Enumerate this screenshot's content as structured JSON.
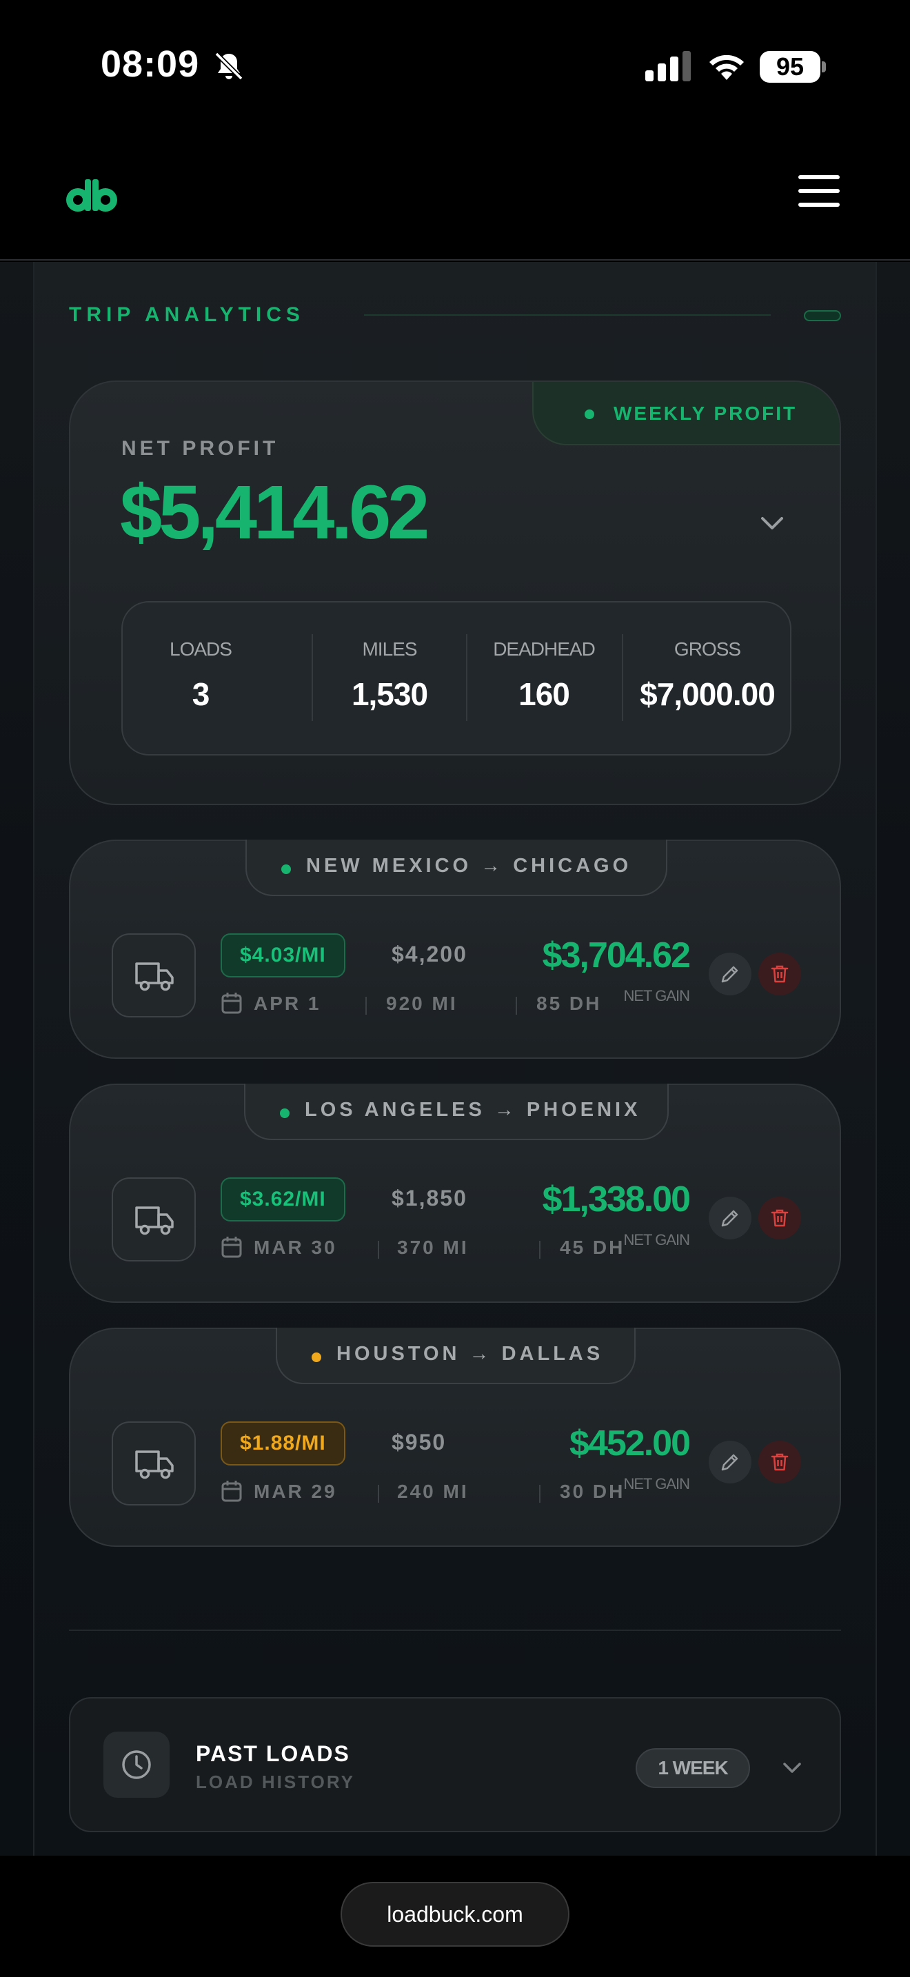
{
  "status_bar": {
    "time": "08:09",
    "battery": "95"
  },
  "header": {
    "logo_icon": "loadbuck-logo",
    "menu_icon": "hamburger-menu-icon"
  },
  "section": {
    "title": "TRIP ANALYTICS"
  },
  "summary": {
    "period_label": "WEEKLY PROFIT",
    "net_profit_label": "NET PROFIT",
    "net_profit_value": "$5,414.62",
    "stats": [
      {
        "label": "LOADS",
        "value": "3"
      },
      {
        "label": "MILES",
        "value": "1,530"
      },
      {
        "label": "DEADHEAD",
        "value": "160"
      },
      {
        "label": "GROSS",
        "value": "$7,000.00"
      }
    ]
  },
  "trips": [
    {
      "route": "NEW MEXICO → CHICAGO",
      "rate": "$4.03/MI",
      "gross": "$4,200",
      "date": "APR 1",
      "miles": "920 MI",
      "deadhead": "85 DH",
      "net_gain": "$3,704.62",
      "net_gain_label": "NET GAIN",
      "status_color": "#16b46f"
    },
    {
      "route": "LOS ANGELES → PHOENIX",
      "rate": "$3.62/MI",
      "gross": "$1,850",
      "date": "MAR 30",
      "miles": "370 MI",
      "deadhead": "45 DH",
      "net_gain": "$1,338.00",
      "net_gain_label": "NET GAIN",
      "status_color": "#16b46f"
    },
    {
      "route": "HOUSTON → DALLAS",
      "rate": "$1.88/MI",
      "gross": "$950",
      "date": "MAR 29",
      "miles": "240 MI",
      "deadhead": "30 DH",
      "net_gain": "$452.00",
      "net_gain_label": "NET GAIN",
      "status_color": "#f0a81c"
    }
  ],
  "past_loads": {
    "title": "PAST LOADS",
    "subtitle": "LOAD HISTORY",
    "range": "1 WEEK"
  },
  "browser": {
    "url": "loadbuck.com"
  },
  "colors": {
    "accent": "#16b46f",
    "warning": "#f0a81c",
    "danger": "#d9413f",
    "background": "#0e1216"
  }
}
